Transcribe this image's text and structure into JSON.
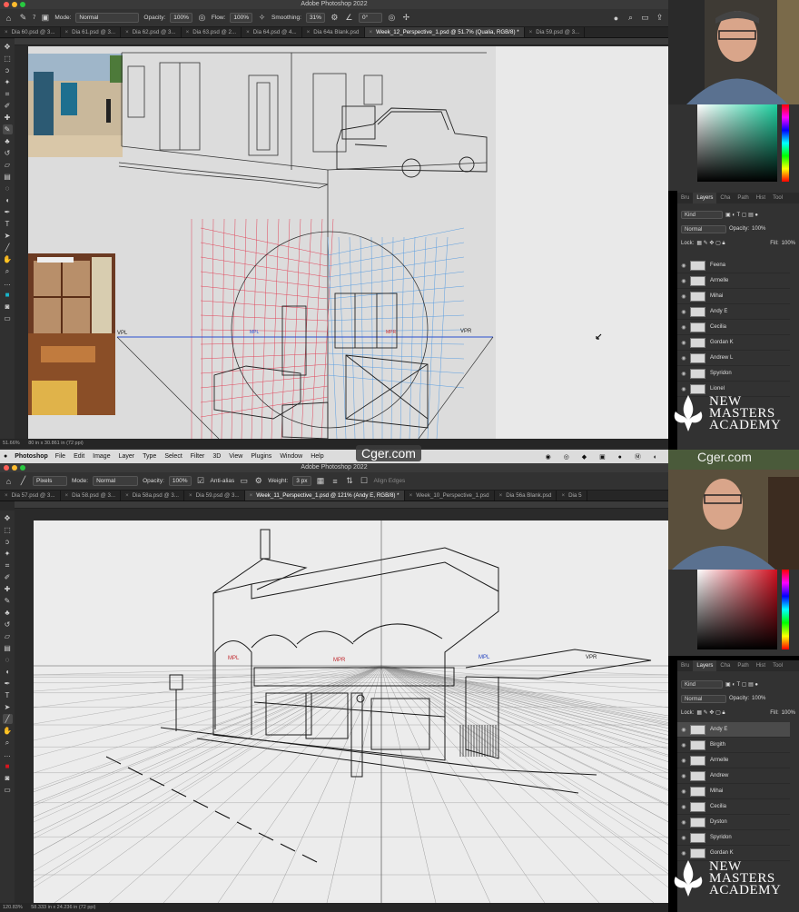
{
  "top": {
    "title": "Adobe Photoshop 2022",
    "options": {
      "mode_label": "Mode:",
      "mode_value": "Normal",
      "opacity_label": "Opacity:",
      "opacity_value": "100%",
      "flow_label": "Flow:",
      "flow_value": "100%",
      "smoothing_label": "Smoothing:",
      "smoothing_value": "31%",
      "angle_value": "0°",
      "brush_size": "7"
    },
    "tabs": [
      {
        "label": "Dia 60.psd @ 3..."
      },
      {
        "label": "Dia 61.psd @ 3..."
      },
      {
        "label": "Dia 62.psd @ 3..."
      },
      {
        "label": "Dia 63.psd @ 2..."
      },
      {
        "label": "Dia 64.psd @ 4..."
      },
      {
        "label": "Dia 64a Blank.psd"
      },
      {
        "label": "Week_12_Perspective_1.psd @ 51.7% (Qualia, RGB/8) *"
      },
      {
        "label": "Dia 59.psd @ 3..."
      }
    ],
    "canvas_labels": {
      "vpl": "VPL",
      "vpr": "VPR",
      "mpl": "MPL",
      "mpr": "MPR"
    },
    "status": {
      "zoom": "51.66%",
      "doc": "80 in x 30.861 in (72 ppi)"
    },
    "layers_tabs": [
      "Bru",
      "Layers",
      "Cha",
      "Path",
      "Hist",
      "Tool"
    ],
    "kind_label": "Kind",
    "blend": "Normal",
    "opacity_label": "Opacity:",
    "opacity": "100%",
    "lock_label": "Lock:",
    "fill_label": "Fill:",
    "fill": "100%",
    "layers": [
      "Feena",
      "Armelle",
      "Mihai",
      "Andy E",
      "Cecilia",
      "Gordan K",
      "Andrew L",
      "Spyridon",
      "Lionel"
    ]
  },
  "menubar": {
    "app": "Photoshop",
    "items": [
      "File",
      "Edit",
      "Image",
      "Layer",
      "Type",
      "Select",
      "Filter",
      "3D",
      "View",
      "Plugins",
      "Window",
      "Help"
    ]
  },
  "bottom": {
    "title": "Adobe Photoshop 2022",
    "options": {
      "pixels_value": "Pixels",
      "mode_label": "Mode:",
      "mode_value": "Normal",
      "opacity_label": "Opacity:",
      "opacity_value": "100%",
      "antialias_label": "Anti-alias",
      "weight_label": "Weight:",
      "weight_value": "3 px",
      "align_label": "Align Edges"
    },
    "tabs": [
      {
        "label": "Dia 57.psd @ 3..."
      },
      {
        "label": "Dia 58.psd @ 3..."
      },
      {
        "label": "Dia 58a.psd @ 3..."
      },
      {
        "label": "Dia 59.psd @ 3..."
      },
      {
        "label": "Week_11_Perspective_1.psd @ 121% (Andy E, RGB/8) *"
      },
      {
        "label": "Week_10_Perspective_1.psd"
      },
      {
        "label": "Dia 56a Blank.psd"
      },
      {
        "label": "Dia 5"
      }
    ],
    "canvas_labels": {
      "mpl": "MPL",
      "vpr": "VPR",
      "mpr": "MPR",
      "mpl2": "MPL"
    },
    "status": {
      "zoom": "120.83%",
      "doc": "58.333 in x 24.236 in (72 ppi)"
    },
    "layers_tabs": [
      "Bru",
      "Layers",
      "Cha",
      "Path",
      "Hist",
      "Tool"
    ],
    "kind_label": "Kind",
    "blend": "Normal",
    "opacity_label": "Opacity:",
    "opacity": "100%",
    "lock_label": "Lock:",
    "fill_label": "Fill:",
    "fill": "100%",
    "layers": [
      "Andy E",
      "Birgith",
      "Armelle",
      "Andrew",
      "Mihai",
      "Cecilia",
      "Dyston",
      "Spyridon",
      "Gordan K"
    ]
  },
  "watermark": {
    "cger": "Cger.com",
    "cger_cam": "Cger.com"
  },
  "brand": {
    "line1": "NEW",
    "line2": "MASTERS",
    "line3": "ACADEMY"
  },
  "colors": {
    "accent": "#1473e6",
    "red_line": "#e0455a",
    "blue_line": "#5b9ee0",
    "horizon": "#2a4fd1"
  }
}
